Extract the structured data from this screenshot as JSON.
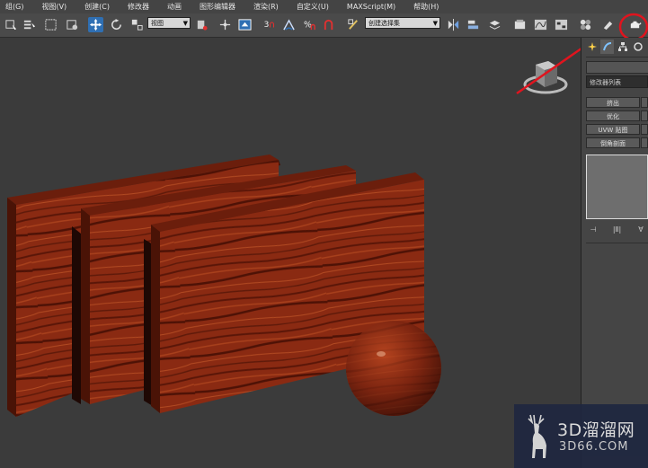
{
  "menu": {
    "items": [
      "组(G)",
      "视图(V)",
      "创建(C)",
      "修改器",
      "动画",
      "图形编辑器",
      "渲染(R)",
      "自定义(U)",
      "MAXScript(M)",
      "帮助(H)"
    ]
  },
  "toolbar": {
    "view_dropdown": "视图",
    "selection_set_dropdown": "创建选择集",
    "snap_label": "3",
    "icons": [
      "select-icon",
      "select-by-name-icon",
      "region-select-icon",
      "window-crossing-icon",
      "move-icon",
      "rotate-icon",
      "scale-icon",
      "pivot-icon",
      "manipulate-icon",
      "snap-icon",
      "angle-snap-icon",
      "percent-snap-icon",
      "spinner-snap-icon",
      "edit-named-selection-icon",
      "mirror-icon",
      "align-icon",
      "layer-icon",
      "graphite-icon",
      "curve-editor-icon",
      "schematic-icon",
      "material-editor-icon",
      "render-setup-icon",
      "render-frame-icon",
      "render-icon"
    ],
    "accent": "#2f6fb3"
  },
  "command_panel": {
    "modifier_list": "修改器列表",
    "buttons": [
      "挤出",
      "优化",
      "UVW 贴图",
      "倒角剖面"
    ]
  },
  "annotation": {
    "color": "#e0141e"
  },
  "scene": {
    "wood_color": "#8a2a12",
    "wood_dark": "#4e1206",
    "background": "#3b3b3b"
  },
  "watermark": {
    "title": "3D溜溜网",
    "url": "3D66.COM"
  }
}
